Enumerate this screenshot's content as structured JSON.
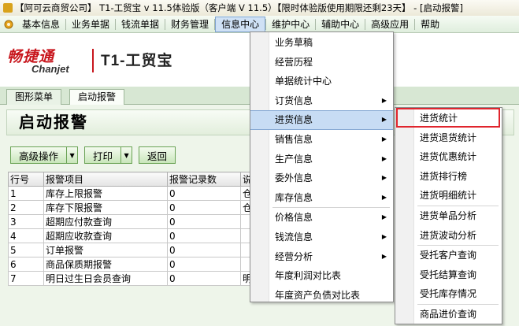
{
  "window": {
    "title": "【阿可云商贸公司】 T1-工贸宝 v 11.5体验版（客户端 V 11.5）【限时体验版使用期限还剩23天】 - [启动报警]"
  },
  "menubar": {
    "items": [
      {
        "label": "基本信息"
      },
      {
        "label": "业务单据"
      },
      {
        "label": "钱流单据"
      },
      {
        "label": "财务管理"
      },
      {
        "label": "信息中心"
      },
      {
        "label": "维护中心"
      },
      {
        "label": "辅助中心"
      },
      {
        "label": "高级应用"
      },
      {
        "label": "帮助"
      }
    ]
  },
  "brand": {
    "cn": "畅捷通",
    "en": "Chanjet",
    "product": "T1-工贸宝",
    "color": "#c8161d"
  },
  "tabs": [
    {
      "label": "图形菜单"
    },
    {
      "label": "启动报警"
    }
  ],
  "panel": {
    "title": "启动报警"
  },
  "toolbar": {
    "advanced_label": "高级操作",
    "print_label": "打印",
    "back_label": "返回"
  },
  "table": {
    "headers": [
      "行号",
      "报警项目",
      "报警记录数",
      "说"
    ],
    "rows": [
      [
        "1",
        "库存上限报警",
        "0",
        "仓"
      ],
      [
        "2",
        "库存下限报警",
        "0",
        "仓"
      ],
      [
        "3",
        "超期应付款查询",
        "0",
        ""
      ],
      [
        "4",
        "超期应收款查询",
        "0",
        ""
      ],
      [
        "5",
        "订单报警",
        "0",
        ""
      ],
      [
        "6",
        "商品保质期报警",
        "0",
        ""
      ],
      [
        "7",
        "明日过生日会员查询",
        "0",
        "明"
      ]
    ]
  },
  "info_menu": {
    "items": [
      {
        "label": "业务草稿",
        "sub": false
      },
      {
        "label": "经营历程",
        "sub": false
      },
      {
        "label": "单据统计中心",
        "sub": false
      },
      {
        "label": "订货信息",
        "sub": true
      },
      {
        "label": "进货信息",
        "sub": true
      },
      {
        "label": "销售信息",
        "sub": true
      },
      {
        "label": "生产信息",
        "sub": true
      },
      {
        "label": "委外信息",
        "sub": true
      },
      {
        "label": "库存信息",
        "sub": true
      },
      {
        "label": "价格信息",
        "sub": true
      },
      {
        "label": "钱流信息",
        "sub": true
      },
      {
        "label": "经营分析",
        "sub": true
      },
      {
        "label": "年度利润对比表",
        "sub": false
      },
      {
        "label": "年度资产负债对比表",
        "sub": false
      }
    ],
    "highlighted": "进货信息"
  },
  "purchase_menu": {
    "items": [
      {
        "label": "进货统计"
      },
      {
        "label": "进货退货统计"
      },
      {
        "label": "进货优惠统计"
      },
      {
        "label": "进货排行榜"
      },
      {
        "label": "进货明细统计"
      },
      {
        "label": "进货单品分析"
      },
      {
        "label": "进货波动分析"
      },
      {
        "label": "受托客户查询"
      },
      {
        "label": "受托结算查询"
      },
      {
        "label": "受托库存情况"
      },
      {
        "label": "商品进价查询"
      }
    ],
    "highlight_color": "#e0252d"
  }
}
